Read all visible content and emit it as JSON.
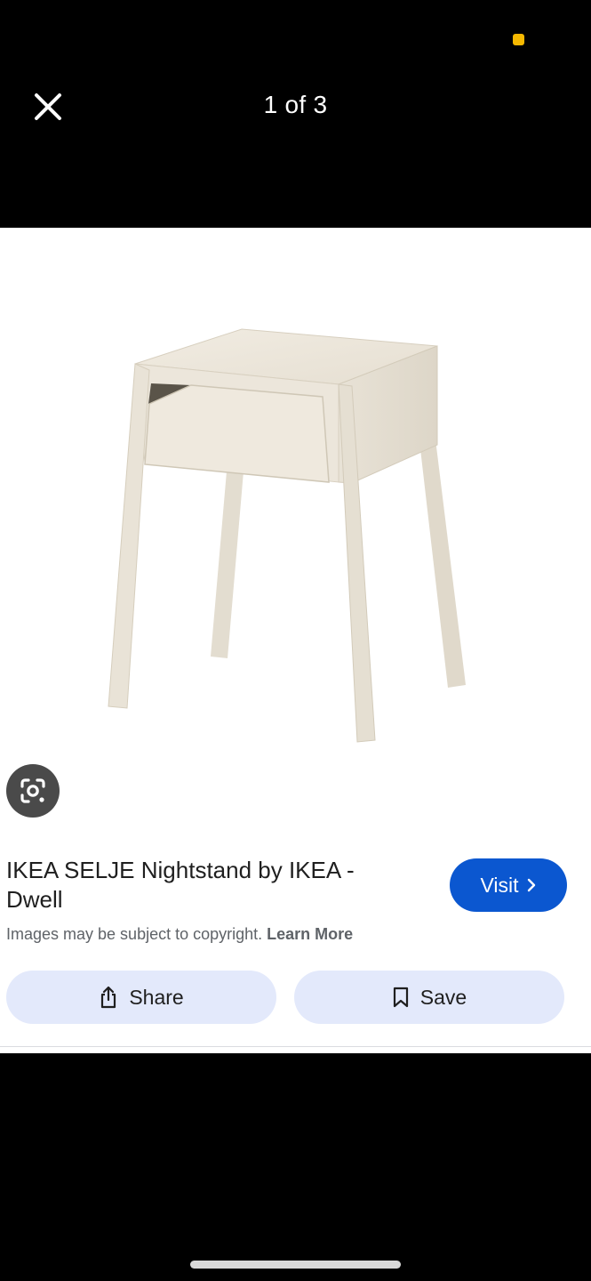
{
  "viewer": {
    "counter": "1 of 3",
    "close_icon": "close-icon"
  },
  "status": {
    "indicator_color": "#f5b800"
  },
  "result": {
    "title": "IKEA SELJE Nightstand by IKEA - Dwell",
    "visit_label": "Visit",
    "visit_color": "#0b57d0",
    "copyright_text": "Images may be subject to copyright.",
    "learn_more_label": "Learn More",
    "share_label": "Share",
    "save_label": "Save"
  },
  "icons": {
    "lens": "google-lens-icon",
    "share": "share-icon",
    "save": "bookmark-icon",
    "visit": "chevron-right-icon"
  }
}
